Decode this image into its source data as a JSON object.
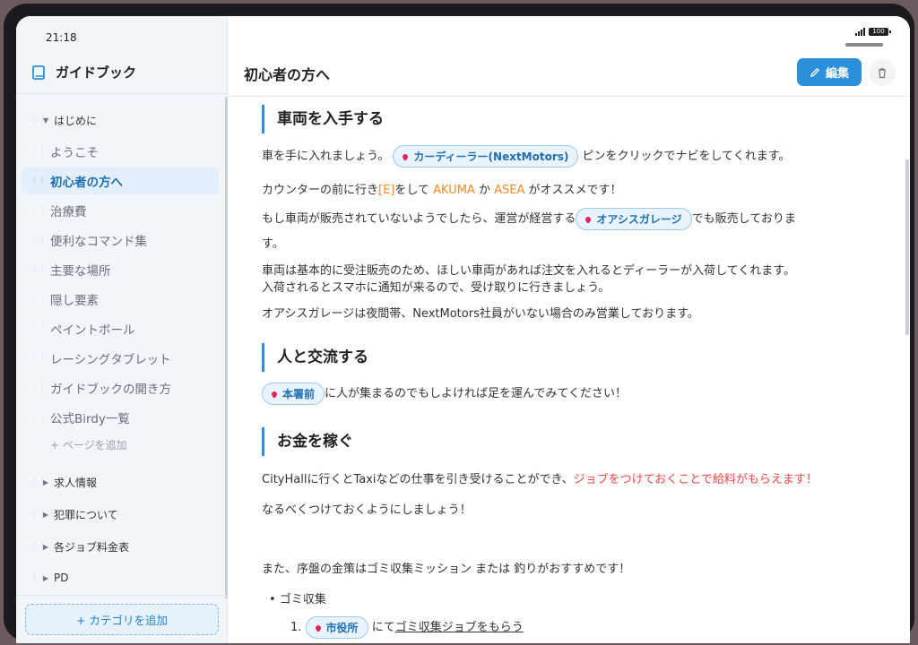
{
  "status": {
    "time": "21:18",
    "battery": "100"
  },
  "sidebar": {
    "brand": "ガイドブック",
    "section_hajimeni": "はじめに",
    "pages": [
      "ようこそ",
      "初心者の方へ",
      "治療費",
      "便利なコマンド集",
      "主要な場所",
      "隠し要素",
      "ペイントボール",
      "レーシングタブレット",
      "ガイドブックの開き方",
      "公式Birdy一覧"
    ],
    "active_page": "初心者の方へ",
    "add_page": "+ ページを追加",
    "other_sections": [
      "求人情報",
      "犯罪について",
      "各ジョブ料金表",
      "PD"
    ],
    "add_category": "+ カテゴリを追加"
  },
  "header": {
    "title": "初心者の方へ",
    "edit_label": "編集"
  },
  "content": {
    "s1_title": "車両を入手する",
    "s1_p1_a": "車を手に入れましょう。",
    "s1_chip_dealer": "カーディーラー(NextMotors)",
    "s1_p1_b": " ピンをクリックでナビをしてくれます。",
    "s1_p2_a": "カウンターの前に行き",
    "s1_p2_key": "[E]",
    "s1_p2_b": "をして ",
    "s1_p2_akuma": "AKUMA",
    "s1_p2_c": " か ",
    "s1_p2_asea": "ASEA",
    "s1_p2_d": " がオススメです！",
    "s1_p3_a": "もし車両が販売されていないようでしたら、運営が経営する",
    "s1_chip_oasis": "オアシスガレージ",
    "s1_p3_b": "でも販売しておりま",
    "s1_p3_c": "す。",
    "s1_p4_a": "車両は基本的に受注販売のため、ほしい車両があれば注文を入れるとディーラーが入荷してくれます。",
    "s1_p4_b": "入荷されるとスマホに通知が来るので、受け取りに行きましょう。",
    "s1_p5": "オアシスガレージは夜間帯、NextMotors社員がいない場合のみ営業しております。",
    "s2_title": "人と交流する",
    "s2_chip": "本署前",
    "s2_p1": "に人が集まるのでもしよければ足を運んでみてください！",
    "s3_title": "お金を稼ぐ",
    "s3_p1_a": "CityHallに行くとTaxiなどの仕事を引き受けることができ、",
    "s3_p1_red": "ジョブをつけておくことで給料がもらえます！",
    "s3_p2": "なるべくつけておくようにしましょう！",
    "s3_p3": "また、序盤の金策はゴミ収集ミッション または 釣りがおすすめです！",
    "s3_bullet": "ゴミ収集",
    "s3_ol_num": "1.",
    "s3_chip_cityhall": "市役所",
    "s3_ol_a": "にて",
    "s3_ol_link": "ゴミ収集ジョブをもらう"
  }
}
